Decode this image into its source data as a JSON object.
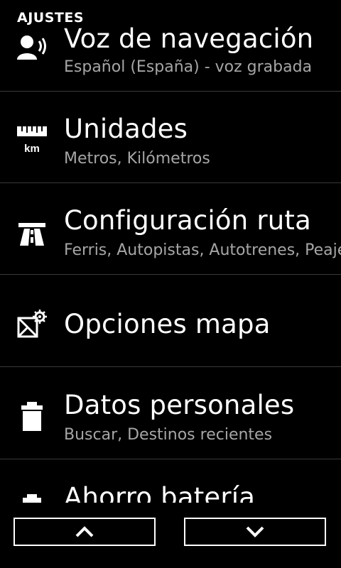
{
  "header": {
    "title": "AJUSTES"
  },
  "items": [
    {
      "title": "Voz de navegación",
      "subtitle": "Español (España) - voz grabada",
      "icon": "voice-speaker-icon"
    },
    {
      "title": "Unidades",
      "subtitle": "Metros, Kilómetros",
      "icon": "ruler-km-icon",
      "icon_text": "km"
    },
    {
      "title": "Configuración ruta",
      "subtitle": "Ferris, Autopistas, Autotrenes, Peajes",
      "icon": "highway-icon"
    },
    {
      "title": "Opciones mapa",
      "subtitle": "",
      "icon": "map-settings-icon"
    },
    {
      "title": "Datos personales",
      "subtitle": "Buscar, Destinos recientes",
      "icon": "trash-icon"
    },
    {
      "title": "Ahorro batería",
      "subtitle": "",
      "icon": "battery-icon"
    }
  ],
  "nav": {
    "up_icon": "chevron-up-icon",
    "down_icon": "chevron-down-icon"
  }
}
